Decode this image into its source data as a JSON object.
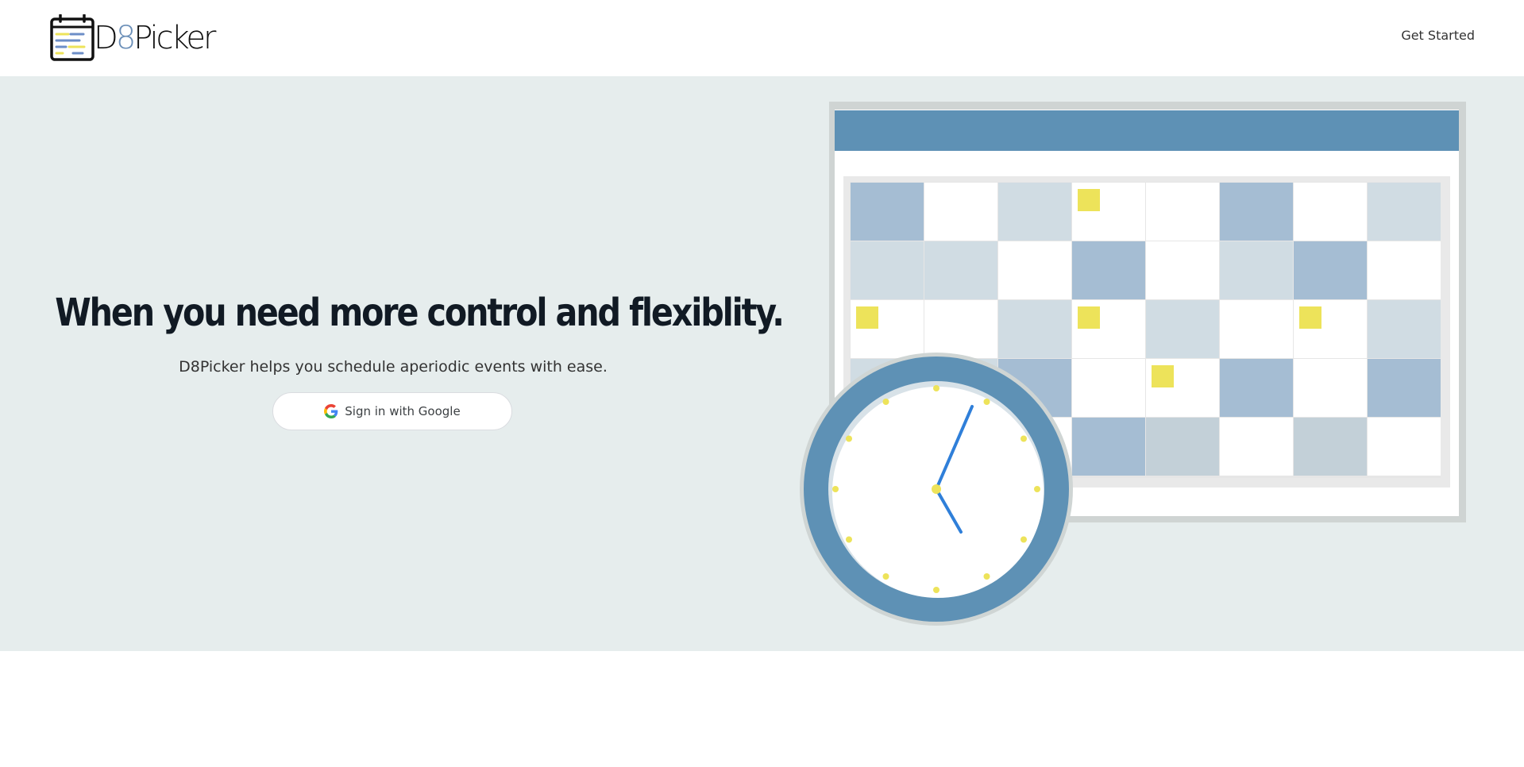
{
  "header": {
    "logo_text_prefix": "D",
    "logo_text_digit": "8",
    "logo_text_suffix": "Picker",
    "nav_link": "Get Started"
  },
  "hero": {
    "headline": "When you need more control and flexiblity.",
    "subtitle": "D8Picker helps you schedule aperiodic events with ease.",
    "signin_button": "Sign in with Google"
  },
  "colors": {
    "hero_background": "#e6eded",
    "calendar_header": "#5e91b5",
    "accent_yellow": "#ede35a",
    "clock_hand": "#2f7fd9",
    "headline_text": "#111a24"
  },
  "icons": [
    "calendar-logo-icon",
    "google-icon",
    "calendar-illustration",
    "clock-illustration"
  ]
}
